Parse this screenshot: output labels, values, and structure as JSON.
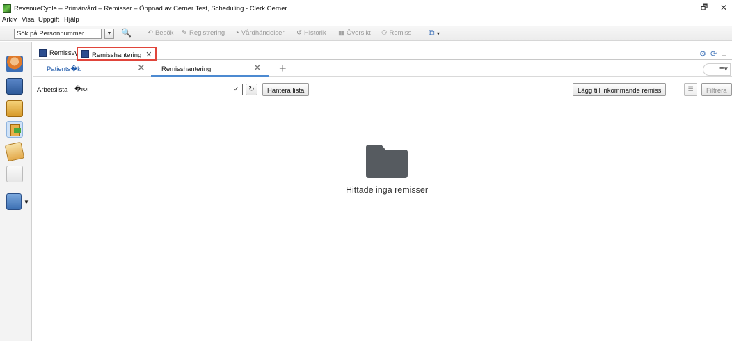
{
  "window": {
    "title": "RevenueCycle – Primärvård – Remisser – Öppnad av Cerner Test, Scheduling - Clerk Cerner",
    "minimize": "–",
    "maximize": "🗗",
    "close": "✕"
  },
  "menu": [
    "Arkiv",
    "Visa",
    "Uppgift",
    "Hjälp"
  ],
  "toolbar": {
    "search_value": "Sök på Personnummer",
    "buttons": [
      "Besök",
      "Registrering",
      "Vårdhändelser",
      "Historik",
      "Översikt",
      "Remiss"
    ]
  },
  "outer_tabs": [
    {
      "label": "Remissvy"
    },
    {
      "label": "Remisshantering",
      "close": "✕"
    }
  ],
  "inner_tabs": [
    {
      "label": "Patients�k"
    },
    {
      "label": "Remisshantering"
    }
  ],
  "worklist": {
    "label": "Arbetslista",
    "selected": "�ron",
    "manage_button": "Hantera lista",
    "add_incoming_button": "Lägg till inkommande remiss",
    "filter_button": "Filtrera"
  },
  "empty_state": {
    "message": "Hittade inga remisser"
  }
}
